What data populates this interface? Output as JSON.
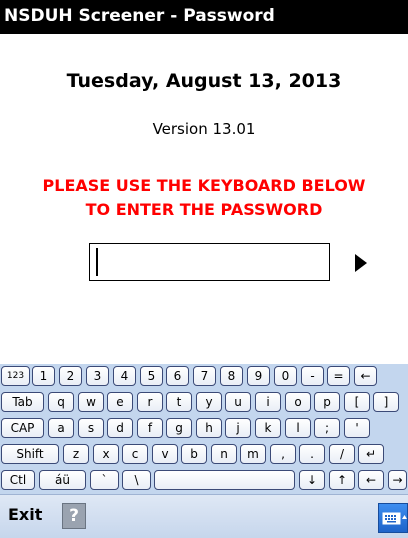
{
  "titlebar": {
    "title": "NSDUH Screener - Password"
  },
  "main": {
    "date": "Tuesday, August 13, 2013",
    "version": "Version 13.01",
    "instruction_line1": "PLEASE USE THE KEYBOARD BELOW",
    "instruction_line2": "TO ENTER THE PASSWORD",
    "password_value": "",
    "go_icon": "right-arrow-icon"
  },
  "keyboard": {
    "rows": [
      [
        {
          "label": "123",
          "name": "key-123",
          "small": true
        },
        {
          "label": "1",
          "name": "key-1"
        },
        {
          "label": "2",
          "name": "key-2"
        },
        {
          "label": "3",
          "name": "key-3"
        },
        {
          "label": "4",
          "name": "key-4"
        },
        {
          "label": "5",
          "name": "key-5"
        },
        {
          "label": "6",
          "name": "key-6"
        },
        {
          "label": "7",
          "name": "key-7"
        },
        {
          "label": "8",
          "name": "key-8"
        },
        {
          "label": "9",
          "name": "key-9"
        },
        {
          "label": "0",
          "name": "key-0"
        },
        {
          "label": "-",
          "name": "key-minus"
        },
        {
          "label": "=",
          "name": "key-equals"
        },
        {
          "label": "←",
          "name": "key-backspace"
        }
      ],
      [
        {
          "label": "Tab",
          "name": "key-tab"
        },
        {
          "label": "q",
          "name": "key-q"
        },
        {
          "label": "w",
          "name": "key-w"
        },
        {
          "label": "e",
          "name": "key-e"
        },
        {
          "label": "r",
          "name": "key-r"
        },
        {
          "label": "t",
          "name": "key-t"
        },
        {
          "label": "y",
          "name": "key-y"
        },
        {
          "label": "u",
          "name": "key-u"
        },
        {
          "label": "i",
          "name": "key-i"
        },
        {
          "label": "o",
          "name": "key-o"
        },
        {
          "label": "p",
          "name": "key-p"
        },
        {
          "label": "[",
          "name": "key-left-bracket"
        },
        {
          "label": "]",
          "name": "key-right-bracket"
        }
      ],
      [
        {
          "label": "CAP",
          "name": "key-caps"
        },
        {
          "label": "a",
          "name": "key-a"
        },
        {
          "label": "s",
          "name": "key-s"
        },
        {
          "label": "d",
          "name": "key-d"
        },
        {
          "label": "f",
          "name": "key-f"
        },
        {
          "label": "g",
          "name": "key-g"
        },
        {
          "label": "h",
          "name": "key-h"
        },
        {
          "label": "j",
          "name": "key-j"
        },
        {
          "label": "k",
          "name": "key-k"
        },
        {
          "label": "l",
          "name": "key-l"
        },
        {
          "label": ";",
          "name": "key-semicolon"
        },
        {
          "label": "'",
          "name": "key-apostrophe"
        }
      ],
      [
        {
          "label": "Shift",
          "name": "key-shift"
        },
        {
          "label": "z",
          "name": "key-z"
        },
        {
          "label": "x",
          "name": "key-x"
        },
        {
          "label": "c",
          "name": "key-c"
        },
        {
          "label": "v",
          "name": "key-v"
        },
        {
          "label": "b",
          "name": "key-b"
        },
        {
          "label": "n",
          "name": "key-n"
        },
        {
          "label": "m",
          "name": "key-m"
        },
        {
          "label": ",",
          "name": "key-comma"
        },
        {
          "label": ".",
          "name": "key-period"
        },
        {
          "label": "/",
          "name": "key-slash"
        },
        {
          "label": "↵",
          "name": "key-enter"
        }
      ],
      [
        {
          "label": "Ctl",
          "name": "key-ctrl"
        },
        {
          "label": "áü",
          "name": "key-accents"
        },
        {
          "label": "`",
          "name": "key-backtick"
        },
        {
          "label": "\\",
          "name": "key-backslash"
        },
        {
          "label": "",
          "name": "key-space"
        },
        {
          "label": "↓",
          "name": "key-down-arrow"
        },
        {
          "label": "↑",
          "name": "key-up-arrow"
        },
        {
          "label": "←",
          "name": "key-left-arrow"
        },
        {
          "label": "→",
          "name": "key-right-arrow"
        }
      ]
    ]
  },
  "bottombar": {
    "exit_label": "Exit",
    "help_label": "?",
    "help_icon": "help-icon",
    "sip_icon": "keyboard-icon"
  },
  "colors": {
    "titlebar_bg": "#000000",
    "instruction_text": "#ff0000",
    "keyboard_bg": "#c3d6ee",
    "sip_button": "#2f7be0"
  }
}
